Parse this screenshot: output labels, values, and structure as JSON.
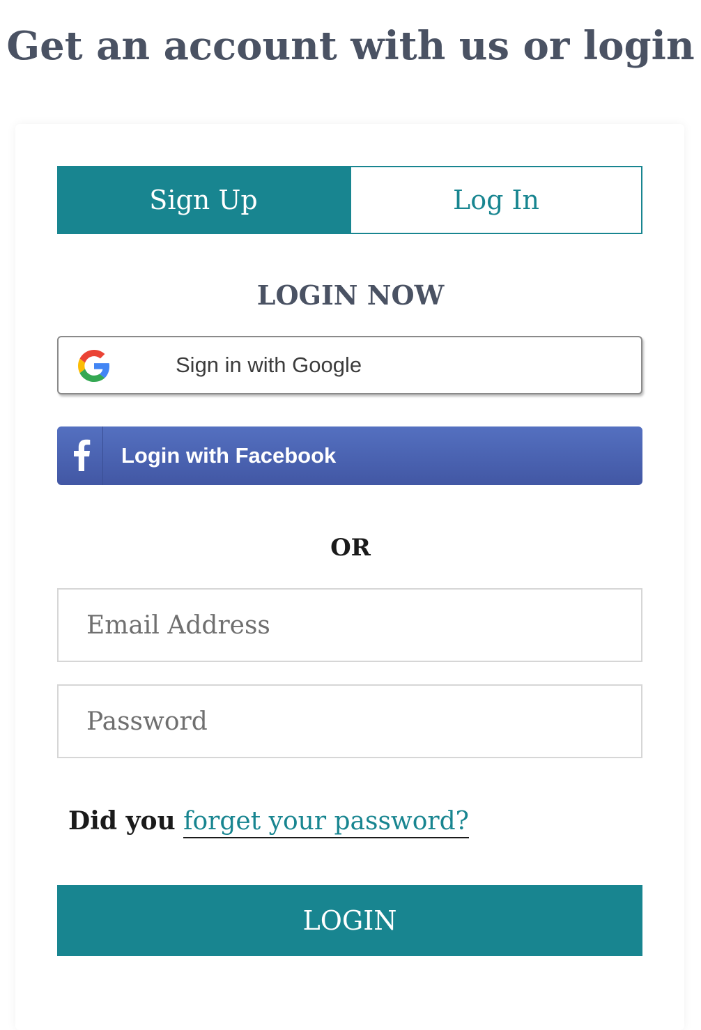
{
  "header": {
    "title": "Get an account with us or login"
  },
  "tabs": [
    {
      "label": "Sign Up",
      "active": true
    },
    {
      "label": "Log In",
      "active": false
    }
  ],
  "login_section": {
    "heading": "LOGIN NOW",
    "google_button": {
      "label": "Sign in with Google",
      "icon": "google-icon"
    },
    "facebook_button": {
      "label": "Login with Facebook",
      "icon": "facebook-icon"
    },
    "divider": "OR"
  },
  "form": {
    "email": {
      "value": "",
      "placeholder": "Email Address"
    },
    "password": {
      "value": "",
      "placeholder": "Password"
    },
    "forgot_prefix": "Did you",
    "forgot_link": "forget your password?",
    "submit_label": "LOGIN"
  },
  "colors": {
    "accent": "#188590",
    "heading": "#4a5263",
    "facebook": "#4a63b0"
  }
}
